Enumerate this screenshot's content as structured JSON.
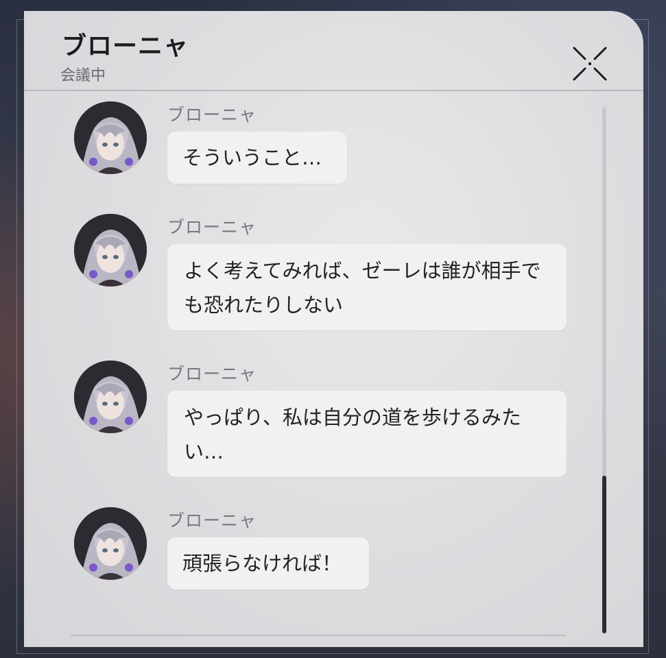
{
  "header": {
    "title": "ブローニャ",
    "status": "会議中",
    "close_icon": "close-x-icon"
  },
  "messages": [
    {
      "sender": "ブローニャ",
      "text": "そういうこと…",
      "avatar": "bronya-avatar"
    },
    {
      "sender": "ブローニャ",
      "text": "よく考えてみれば、ゼーレは誰が相手でも恐れたりしない",
      "avatar": "bronya-avatar"
    },
    {
      "sender": "ブローニャ",
      "text": "やっぱり、私は自分の道を歩けるみたい…",
      "avatar": "bronya-avatar"
    },
    {
      "sender": "ブローニャ",
      "text": "頑張らなければ！",
      "avatar": "bronya-avatar"
    }
  ],
  "scroll": {
    "thumb_start_fraction": 0.7,
    "thumb_end_fraction": 1.0
  },
  "colors": {
    "panel_bg": "#e3e3e5",
    "bubble_bg": "#f1f1f2",
    "title_text": "#1c1c1f",
    "sender_text": "#77777d",
    "scroll_thumb": "#2c2c30"
  }
}
